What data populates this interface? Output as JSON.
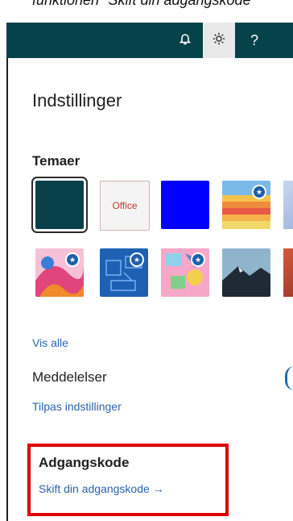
{
  "caption": {
    "text": "funktionen \"Skift din adgangskode\""
  },
  "header": {
    "bell_icon": "bell-icon",
    "gear_icon": "gear-icon",
    "help_label": "?"
  },
  "settings": {
    "title": "Indstillinger",
    "themes": {
      "label": "Temaer",
      "tiles": [
        {
          "name": "dark-teal",
          "color": "#08404a",
          "selected": true
        },
        {
          "name": "office",
          "label": "Office",
          "color": "#f4f4f4"
        },
        {
          "name": "blue",
          "color": "#0000ff"
        },
        {
          "name": "sunset-stripes",
          "premium": true
        },
        {
          "name": "colorful-abstract",
          "premium": true
        },
        {
          "name": "blueprint",
          "premium": true
        },
        {
          "name": "pastel-pattern",
          "premium": true
        },
        {
          "name": "mountain"
        }
      ],
      "show_all": "Vis alle"
    },
    "notifications": {
      "label": "Meddelelser",
      "link": "Tilpas indstillinger"
    },
    "password": {
      "label": "Adgangskode",
      "link": "Skift din adgangskode →"
    }
  },
  "highlight_color": "#e00000",
  "brand_color": "#05424a",
  "link_color": "#2b63b0"
}
